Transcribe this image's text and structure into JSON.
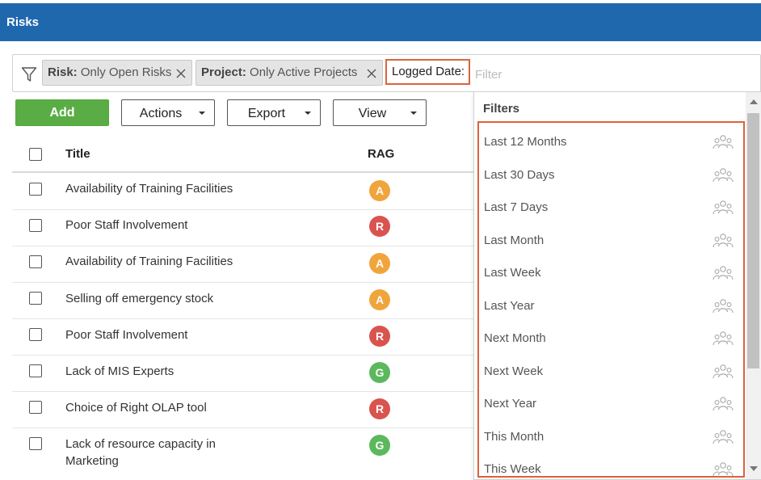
{
  "header": {
    "title": "Risks"
  },
  "filter_bar": {
    "chips": [
      {
        "key": "Risk:",
        "value": "Only Open Risks"
      },
      {
        "key": "Project:",
        "value": "Only Active Projects"
      }
    ],
    "active_field": "Logged Date:",
    "input_placeholder": "Filter",
    "input_value": ""
  },
  "toolbar": {
    "add_label": "Add",
    "actions_label": "Actions",
    "export_label": "Export",
    "view_label": "View"
  },
  "table": {
    "columns": [
      "Title",
      "RAG"
    ],
    "rows": [
      {
        "title": "Availability of Training Facilities",
        "rag": "A"
      },
      {
        "title": "Poor Staff Involvement",
        "rag": "R"
      },
      {
        "title": "Availability of Training Facilities",
        "rag": "A"
      },
      {
        "title": "Selling off emergency stock",
        "rag": "A"
      },
      {
        "title": "Poor Staff Involvement",
        "rag": "R"
      },
      {
        "title": "Lack of MIS Experts",
        "rag": "G"
      },
      {
        "title": "Choice of Right OLAP tool",
        "rag": "R"
      },
      {
        "title": "Lack of resource capacity in Marketing",
        "rag": "G"
      }
    ]
  },
  "rag_colors": {
    "A": "#f0a53c",
    "R": "#d9534f",
    "G": "#5cb85c"
  },
  "accent_colors": {
    "header": "#2068ad",
    "add_button": "#5aad45",
    "highlight": "#d9633e"
  },
  "dropdown": {
    "heading": "Filters",
    "items": [
      {
        "label": "Last 12 Months",
        "icon": "group-icon"
      },
      {
        "label": "Last 30 Days",
        "icon": "group-icon"
      },
      {
        "label": "Last 7 Days",
        "icon": "group-icon"
      },
      {
        "label": "Last Month",
        "icon": "group-icon"
      },
      {
        "label": "Last Week",
        "icon": "group-icon"
      },
      {
        "label": "Last Year",
        "icon": "group-icon"
      },
      {
        "label": "Next Month",
        "icon": "group-icon"
      },
      {
        "label": "Next Week",
        "icon": "group-icon"
      },
      {
        "label": "Next Year",
        "icon": "group-icon"
      },
      {
        "label": "This Month",
        "icon": "group-icon"
      },
      {
        "label": "This Week",
        "icon": "group-icon"
      }
    ]
  }
}
